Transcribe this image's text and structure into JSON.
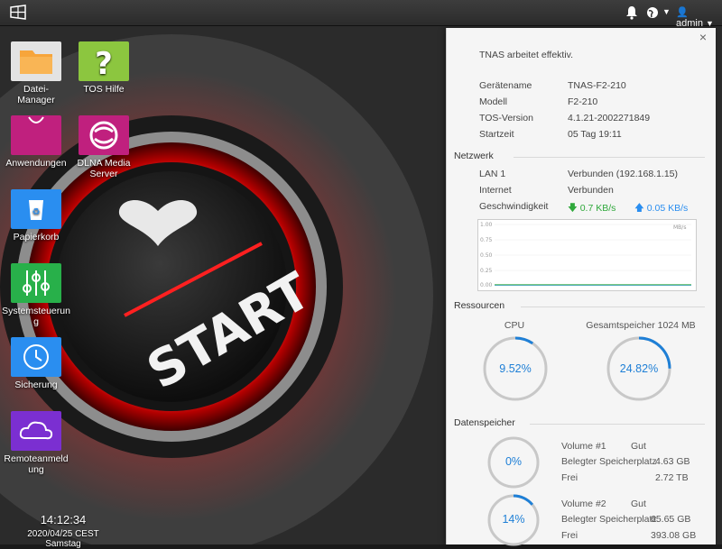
{
  "topbar": {
    "user": "admin",
    "icons": [
      "windows-start-icon",
      "bell-icon",
      "globe-icon",
      "user-icon"
    ]
  },
  "desktop": {
    "icons": [
      {
        "label": "Datei-\nManager",
        "icon": "folder-icon",
        "color": "#f7a53b"
      },
      {
        "label": "TOS Hilfe",
        "icon": "question-icon",
        "color": "#8cc63f"
      },
      {
        "label": "Anwendungen",
        "icon": "shopping-bag-icon",
        "color": "#c0207e"
      },
      {
        "label": "DLNA Media Server",
        "icon": "dlna-icon",
        "color": "#c0207e"
      },
      {
        "label": "Papierkorb",
        "icon": "trash-icon",
        "color": "#2a8ef0"
      },
      {
        "label": "Systemsteuerung",
        "icon": "sliders-icon",
        "color": "#28b04a"
      },
      {
        "label": "Sicherung",
        "icon": "clock-back-icon",
        "color": "#2a8ef0"
      },
      {
        "label": "Remoteanmeldung",
        "icon": "cloud-icon",
        "color": "#7b2fd1"
      }
    ]
  },
  "clock": {
    "time": "14:12:34",
    "date": "2020/04/25 CEST Samstag"
  },
  "wallpaper": {
    "button_text": "START"
  },
  "panel": {
    "status": "TNAS arbeitet effektiv.",
    "device": [
      {
        "key": "Gerätename",
        "value": "TNAS-F2-210"
      },
      {
        "key": "Modell",
        "value": "F2-210"
      },
      {
        "key": "TOS-Version",
        "value": "4.1.21-2002271849"
      },
      {
        "key": "Startzeit",
        "value": "05 Tag 19:11"
      }
    ],
    "network": {
      "title": "Netzwerk",
      "lan_key": "LAN 1",
      "lan_value": "Verbunden (192.168.1.15)",
      "internet_key": "Internet",
      "internet_value": "Verbunden",
      "speed_key": "Geschwindigkeit",
      "down": "0.7 KB/s",
      "up": "0.05 KB/s",
      "chart_unit": "MB/s",
      "chart_ticks": [
        "1.00",
        "0.75",
        "0.50",
        "0.25",
        "0.00"
      ],
      "down_color": "#2fa83b",
      "up_color": "#2a8ef0"
    },
    "resources": {
      "title": "Ressourcen",
      "cpu_label": "CPU",
      "cpu_value": "9.52%",
      "cpu_pct": 9.52,
      "mem_label": "Gesamtspeicher 1024 MB",
      "mem_value": "24.82%",
      "mem_pct": 24.82
    },
    "storage": {
      "title": "Datenspeicher",
      "volumes": [
        {
          "name": "Volume #1",
          "status": "Gut",
          "used_key": "Belegter Speicherplatz",
          "used": "4.63 GB",
          "free_key": "Frei",
          "free": "2.72 TB",
          "pct_label": "0%",
          "pct": 0
        },
        {
          "name": "Volume #2",
          "status": "Gut",
          "used_key": "Belegter Speicherplatz",
          "used": "65.65 GB",
          "free_key": "Frei",
          "free": "393.08 GB",
          "pct_label": "14%",
          "pct": 14
        }
      ]
    }
  }
}
